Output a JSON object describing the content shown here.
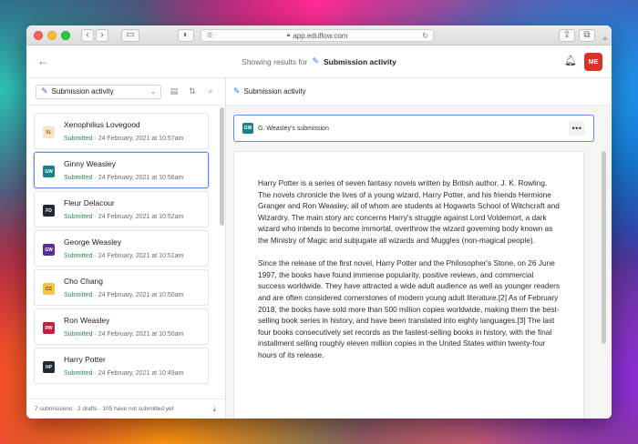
{
  "browser": {
    "url": "app.eduflow.com"
  },
  "header": {
    "prefix": "Showing results for",
    "title": "Submission activity",
    "user_initials": "ME"
  },
  "left": {
    "filter_label": "Submission activity",
    "items": [
      {
        "initials": "XL",
        "name": "Xenophilius Lovegood",
        "status": "Submitted",
        "time": " · 24 February, 2021 at 10:57am",
        "badge_bg": "#fbe3c7",
        "badge_fg": "#8a5a20"
      },
      {
        "initials": "GW",
        "name": "Ginny Weasley",
        "status": "Submitted",
        "time": " · 24 February, 2021 at 10:56am",
        "badge_bg": "#17808c",
        "badge_fg": "#ffffff"
      },
      {
        "initials": "FD",
        "name": "Fleur Delacour",
        "status": "Submitted",
        "time": " · 24 February, 2021 at 10:52am",
        "badge_bg": "#1f2a36",
        "badge_fg": "#ffffff"
      },
      {
        "initials": "GW",
        "name": "George Weasley",
        "status": "Submitted",
        "time": " · 24 February, 2021 at 10:51am",
        "badge_bg": "#5b2d91",
        "badge_fg": "#ffffff"
      },
      {
        "initials": "CC",
        "name": "Cho Chang",
        "status": "Submitted",
        "time": " · 24 February, 2021 at 10:50am",
        "badge_bg": "#f5c542",
        "badge_fg": "#5a4300"
      },
      {
        "initials": "RW",
        "name": "Ron Weasley",
        "status": "Submitted",
        "time": " · 24 February, 2021 at 10:50am",
        "badge_bg": "#c2203a",
        "badge_fg": "#ffffff"
      },
      {
        "initials": "HP",
        "name": "Harry Potter",
        "status": "Submitted",
        "time": " · 24 February, 2021 at 10:49am",
        "badge_bg": "#1f2a36",
        "badge_fg": "#ffffff"
      }
    ],
    "footer": "7 submissions · 2 drafts · 105 have not submitted yet"
  },
  "right": {
    "toolbar_label": "Submission activity",
    "submission_initials": "GW",
    "submission_title": "G. Weasley's submission",
    "more_label": "•••",
    "paragraphs": [
      "Harry Potter is a series of seven fantasy novels written by British author, J. K. Rowling. The novels chronicle the lives of a young wizard, Harry Potter, and his friends Hermione Granger and Ron Weasley, all of whom are students at Hogwarts School of Witchcraft and Wizardry. The main story arc concerns Harry's struggle against Lord Voldemort, a dark wizard who intends to become immortal, overthrow the wizard governing body known as the Ministry of Magic and subjugate all wizards and Muggles (non-magical people).",
      "Since the release of the first novel, Harry Potter and the Philosopher's Stone, on 26 June 1997, the books have found immense popularity, positive reviews, and commercial success worldwide. They have attracted a wide adult audience as well as younger readers and are often considered cornerstones of modern young adult literature.[2] As of February 2018, the books have sold more than 500 million copies worldwide, making them the best-selling book series in history, and have been translated into eighty languages.[3] The last four books consecutively set records as the fastest-selling books in history, with the final installment selling roughly eleven million copies in the United States within twenty-four hours of its release."
    ]
  },
  "colors": {
    "accent": "#3a6fd8",
    "submitted": "#2f8a4d",
    "selected_border": "#5b8def",
    "avatar_me": "#d9342b"
  },
  "icons": {
    "back": "arrow-left-icon",
    "pen": "pen-icon",
    "bell": "bell-icon",
    "filter": "filter-icon",
    "sort": "sort-icon",
    "search": "search-icon",
    "download": "download-icon"
  }
}
